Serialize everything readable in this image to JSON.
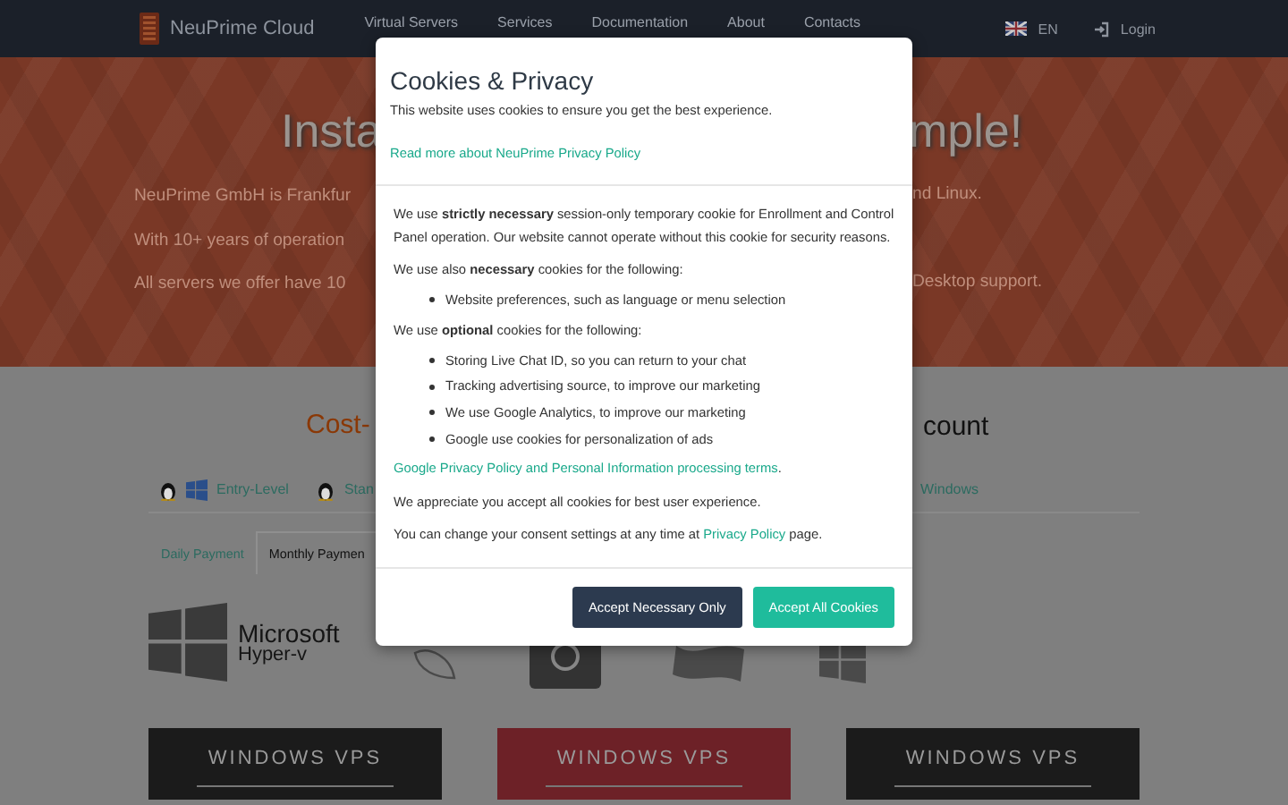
{
  "nav": {
    "brand": "NeuPrime Cloud",
    "links": [
      "Virtual Servers",
      "Services",
      "Documentation",
      "About",
      "Contacts"
    ],
    "language": "EN",
    "login": "Login"
  },
  "hero": {
    "title_left": "Insta",
    "title_right": "mple!",
    "lines": [
      {
        "left": "NeuPrime GmbH is Frankfur",
        "right": "nd Linux."
      },
      {
        "left": "With 10+ years of operation"
      },
      {
        "left": "All servers we offer have 10",
        "right": "Desktop support."
      }
    ]
  },
  "offers": {
    "heading_left": "Cost-",
    "heading_right": "count",
    "product_tabs": [
      {
        "label": "Entry-Level",
        "linux": true,
        "windows": true
      },
      {
        "label": "Stan",
        "linux": true,
        "windows": false
      }
    ],
    "product_tab_right": "Windows",
    "payment_tabs": [
      {
        "label": "Daily Payment",
        "selected": false
      },
      {
        "label": "Monthly Paymen",
        "selected": true
      }
    ],
    "hyperv_logo": {
      "line_1": "Microsoft",
      "line_2": "Hyper-v"
    },
    "cards": [
      {
        "title": "WINDOWS VPS",
        "highlighted": false
      },
      {
        "title": "WINDOWS VPS",
        "highlighted": true
      },
      {
        "title": "WINDOWS VPS",
        "highlighted": false
      }
    ]
  },
  "modal": {
    "title": "Cookies & Privacy",
    "intro": "This website uses cookies to ensure you get the best experience.",
    "read_more": "Read more about NeuPrime Privacy Policy",
    "body": [
      {
        "kind": "paragraph",
        "text": "We use **strictly necessary** session-only temporary cookie for Enrollment and Control Panel operation. Our website cannot operate without this cookie for security reasons."
      },
      {
        "kind": "paragraph",
        "text": "We use also **necessary** cookies for the following:"
      },
      {
        "kind": "list",
        "items": [
          "Website preferences, such as language or menu selection"
        ]
      },
      {
        "kind": "paragraph",
        "text": "We use **optional** cookies for the following:"
      },
      {
        "kind": "list",
        "items": [
          "Storing Live Chat ID, so you can return to your chat",
          "Tracking advertising source, to improve our marketing",
          "We use Google Analytics, to improve our marketing",
          "Google use cookies for personalization of ads"
        ]
      },
      {
        "kind": "link",
        "link": "Google Privacy Policy and Personal Information processing terms",
        "after": "."
      },
      {
        "kind": "paragraph",
        "text": "We appreciate you accept all cookies for best user experience."
      },
      {
        "kind": "link",
        "before": "You can change your consent settings at any time at ",
        "link": "Privacy Policy",
        "after": " page."
      }
    ],
    "buttons": [
      {
        "label": "Accept Necessary Only",
        "kind": "secondary"
      },
      {
        "label": "Accept All Cookies",
        "kind": "primary"
      }
    ]
  }
}
